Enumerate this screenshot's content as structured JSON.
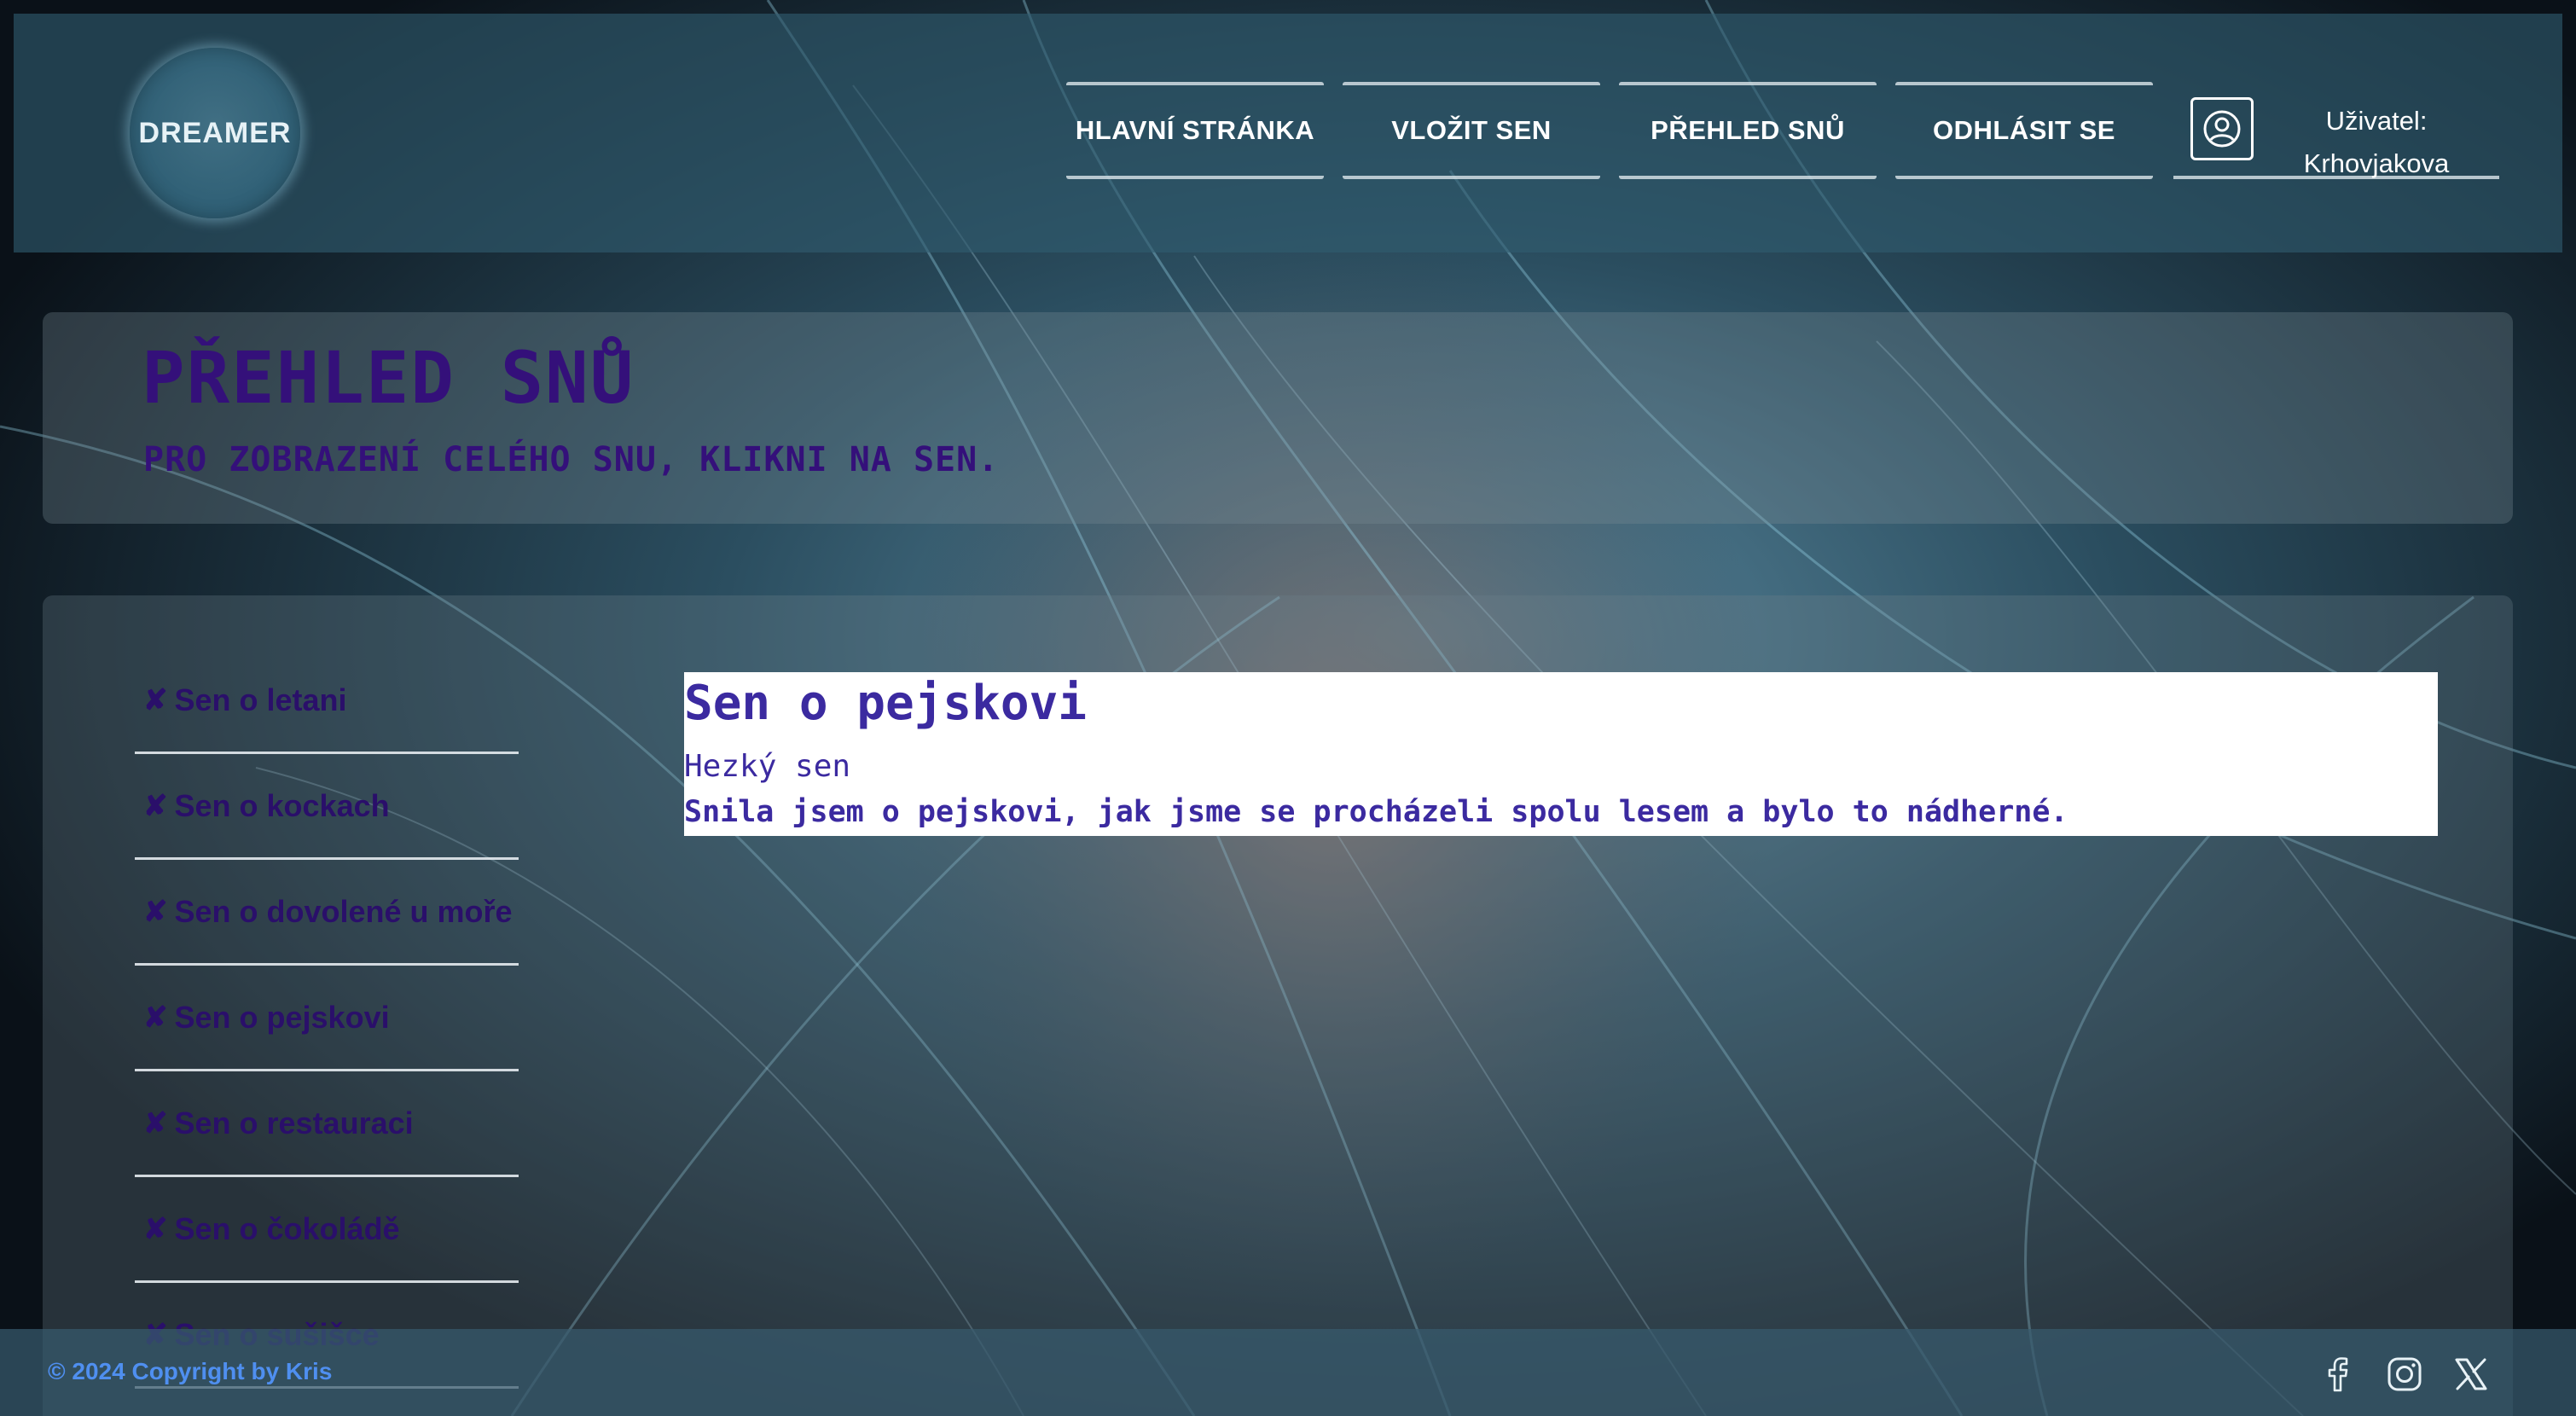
{
  "header": {
    "logo_text": "DREAMER",
    "nav": [
      {
        "label": "HLAVNÍ STRÁNKA"
      },
      {
        "label": "VLOŽIT SEN"
      },
      {
        "label": "PŘEHLED SNŮ"
      },
      {
        "label": "ODHLÁSIT SE"
      }
    ],
    "user": {
      "label": "Uživatel:",
      "name": "Krhovjakova",
      "icon": "user-circle-icon"
    }
  },
  "title_panel": {
    "title": "PŘEHLED SNŮ",
    "subtitle": "PRO ZOBRAZENÍ CELÉHO SNU, KLIKNI NA SEN."
  },
  "dream_list": {
    "delete_glyph": "✘",
    "items": [
      {
        "name": "Sen o letani"
      },
      {
        "name": "Sen o kockach"
      },
      {
        "name": "Sen o dovolené u moře"
      },
      {
        "name": "Sen o pejskovi"
      },
      {
        "name": "Sen o restauraci"
      },
      {
        "name": "Sen o čokoládě"
      },
      {
        "name": "Sen o sušišce"
      }
    ]
  },
  "dream_detail": {
    "title": "Sen o pejskovi",
    "subtitle": "Hezký sen",
    "text": "Snila jsem o pejskovi, jak jsme se procházeli spolu lesem a bylo to nádherné."
  },
  "footer": {
    "copyright": "© 2024 Copyright by Kris",
    "social": [
      {
        "icon": "facebook-icon"
      },
      {
        "icon": "instagram-icon"
      },
      {
        "icon": "x-twitter-icon"
      }
    ]
  },
  "colors": {
    "accent_purple": "#34107a",
    "card_text": "#3b2aa0",
    "footer_link": "#4f8ff0",
    "header_bg": "#305c70"
  }
}
